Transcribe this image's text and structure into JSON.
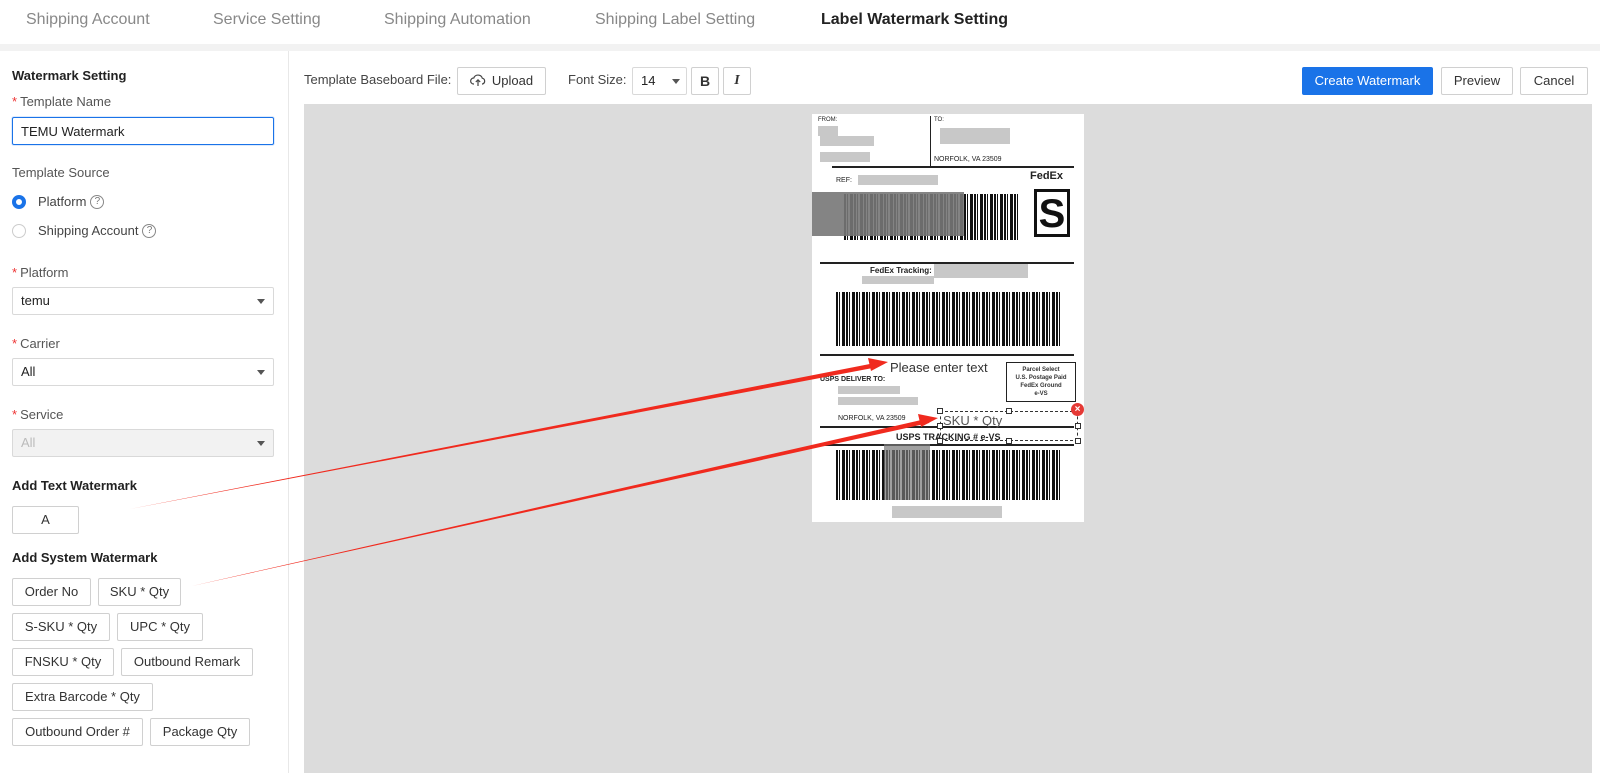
{
  "tabs": [
    "Shipping Account",
    "Service Setting",
    "Shipping Automation",
    "Shipping Label Setting",
    "Label Watermark Setting"
  ],
  "sidebar": {
    "section_title": "Watermark Setting",
    "template_name_label": "Template Name",
    "template_name_value": "TEMU Watermark",
    "template_source_label": "Template Source",
    "source_options": [
      "Platform",
      "Shipping Account"
    ],
    "selected_source": "Platform",
    "platform_label": "Platform",
    "platform_value": "temu",
    "carrier_label": "Carrier",
    "carrier_value": "All",
    "service_label": "Service",
    "service_value": "All",
    "add_text_title": "Add Text Watermark",
    "add_text_button": "A",
    "add_system_title": "Add System Watermark",
    "system_buttons": [
      "Order No",
      "SKU * Qty",
      "S-SKU * Qty",
      "UPC * Qty",
      "FNSKU * Qty",
      "Outbound Remark",
      "Extra Barcode * Qty",
      "Outbound Order #",
      "Package Qty"
    ]
  },
  "toolbar": {
    "baseboard_label": "Template Baseboard File:",
    "upload_label": "Upload",
    "font_size_label": "Font Size:",
    "font_size_value": "14",
    "bold_label": "B",
    "italic_label": "I",
    "create_label": "Create Watermark",
    "preview_label": "Preview",
    "cancel_label": "Cancel"
  },
  "shipping_label": {
    "from": "FROM:",
    "to": "TO:",
    "to_city": "NORFOLK, VA 23509",
    "ref": "REF:",
    "carrier_logo": "FedEx",
    "service_letter": "S",
    "tracking_label": "FedEx Tracking:",
    "parcel_box": [
      "Parcel Select",
      "U.S. Postage Paid",
      "FedEx Ground",
      "e-VS"
    ],
    "usps_deliver_to": "USPS DELIVER TO:",
    "usps_city": "NORFOLK, VA 23509",
    "usps_tracking": "USPS TRACKING # e-VS",
    "watermark_text_placeholder": "Please enter text",
    "watermark_sku": "SKU * Qty"
  },
  "colors": {
    "primary": "#1a73e8",
    "arrow": "#f02a1e",
    "canvas": "#dcdcdc"
  }
}
